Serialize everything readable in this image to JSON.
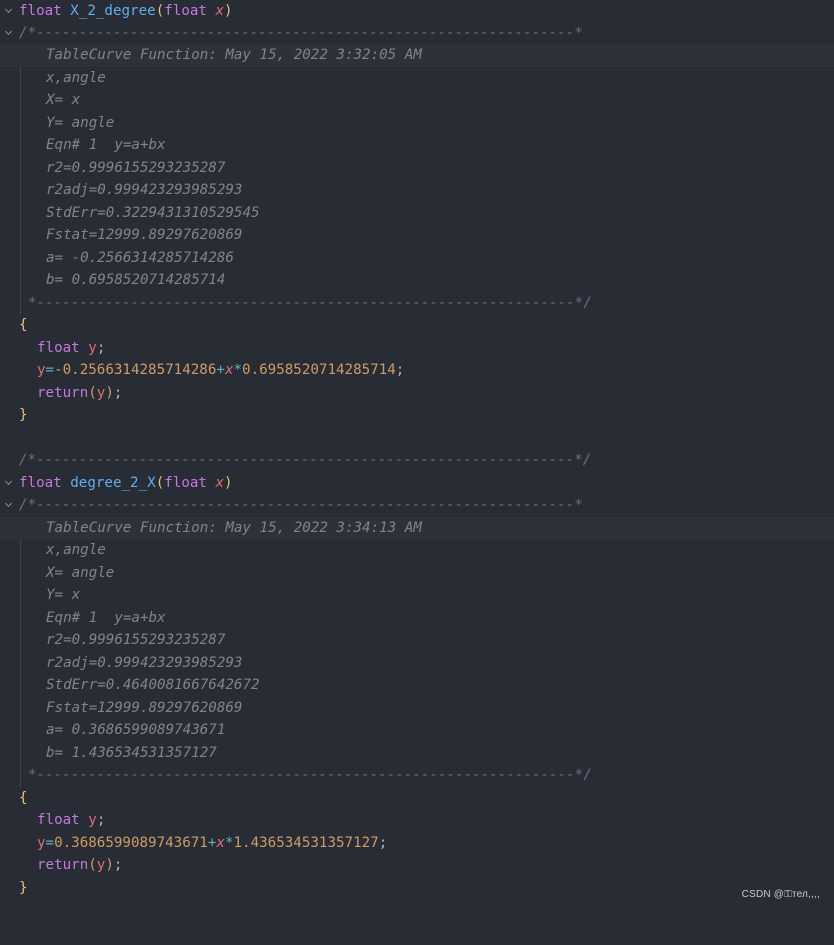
{
  "block1": {
    "sig": {
      "kw1": "float",
      "name": "X_2_degree",
      "open": "(",
      "kw2": "float",
      "param": "x",
      "close": ")"
    },
    "comment_open": "/*---------------------------------------------------------------*",
    "comment_lines": [
      "TableCurve Function: May 15, 2022 3:32:05 AM",
      "x,angle",
      "X= x",
      "Y= angle",
      "Eqn# 1  y=a+bx",
      "r2=0.9996155293235287",
      "r2adj=0.999423293985293",
      "StdErr=0.3229431310529545",
      "Fstat=12999.89297620869",
      "a= -0.2566314285714286",
      "b= 0.6958520714285714"
    ],
    "comment_close": "*---------------------------------------------------------------*/",
    "brace_open": "{",
    "decl": {
      "kw": "float",
      "var": "y",
      "semi": ";"
    },
    "assign": {
      "var": "y",
      "eq": "=",
      "num1": "-0.2566314285714286",
      "plus": "+",
      "x": "x",
      "star": "*",
      "num2": "0.6958520714285714",
      "semi": ";"
    },
    "ret": {
      "kw": "return",
      "open": "(",
      "var": "y",
      "close": ")",
      "semi": ";"
    },
    "brace_close": "}"
  },
  "separator": "/*---------------------------------------------------------------*/",
  "block2": {
    "sig": {
      "kw1": "float",
      "name": "degree_2_X",
      "open": "(",
      "kw2": "float",
      "param": "x",
      "close": ")"
    },
    "comment_open": "/*---------------------------------------------------------------*",
    "comment_lines": [
      "TableCurve Function: May 15, 2022 3:34:13 AM",
      "x,angle",
      "X= angle",
      "Y= x",
      "Eqn# 1  y=a+bx",
      "r2=0.9996155293235287",
      "r2adj=0.999423293985293",
      "StdErr=0.4640081667642672",
      "Fstat=12999.89297620869",
      "a= 0.3686599089743671",
      "b= 1.436534531357127"
    ],
    "comment_close": "*---------------------------------------------------------------*/",
    "brace_open": "{",
    "decl": {
      "kw": "float",
      "var": "y",
      "semi": ";"
    },
    "assign": {
      "var": "y",
      "eq": "=",
      "num1": "0.3686599089743671",
      "plus": "+",
      "x": "x",
      "star": "*",
      "num2": "1.436534531357127",
      "semi": ";"
    },
    "ret": {
      "kw": "return",
      "open": "(",
      "var": "y",
      "close": ")",
      "semi": ";"
    },
    "brace_close": "}"
  },
  "watermark": "CSDN @⚿тел,,,,"
}
